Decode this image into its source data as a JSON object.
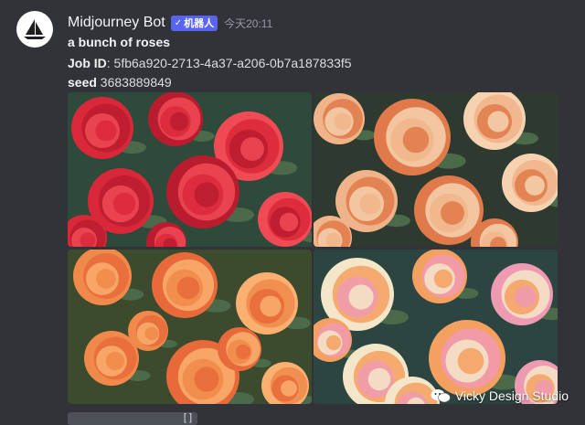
{
  "message": {
    "author": "Midjourney Bot",
    "badge_check": "✓",
    "badge_label": "机器人",
    "timestamp": "今天20:11",
    "prompt": "a bunch of roses",
    "job_id_label": "Job ID",
    "job_id_value": ": 5fb6a920-2713-4a37-a206-0b7a187833f5",
    "seed_label": "seed",
    "seed_value": " 3683889849"
  },
  "images": [
    {
      "name": "rose-image-1",
      "palette": [
        "#2d4a3a",
        "#d9283a",
        "#b81c2e",
        "#f04a55"
      ]
    },
    {
      "name": "rose-image-2",
      "palette": [
        "#2e3a2f",
        "#f0b48a",
        "#e07a4a",
        "#f6d2b0"
      ]
    },
    {
      "name": "rose-image-3",
      "palette": [
        "#3c4a2e",
        "#f08a4a",
        "#e86a3a",
        "#f9b070"
      ]
    },
    {
      "name": "rose-image-4",
      "palette": [
        "#2d4540",
        "#f4e6c8",
        "#f4a060",
        "#ee9ab2"
      ]
    }
  ],
  "watermark": "Vicky Design Studio",
  "colors": {
    "background": "#313338",
    "badge": "#5865f2"
  },
  "icons": {
    "avatar": "sailboat-logo-icon",
    "watermark": "wechat-icon"
  }
}
